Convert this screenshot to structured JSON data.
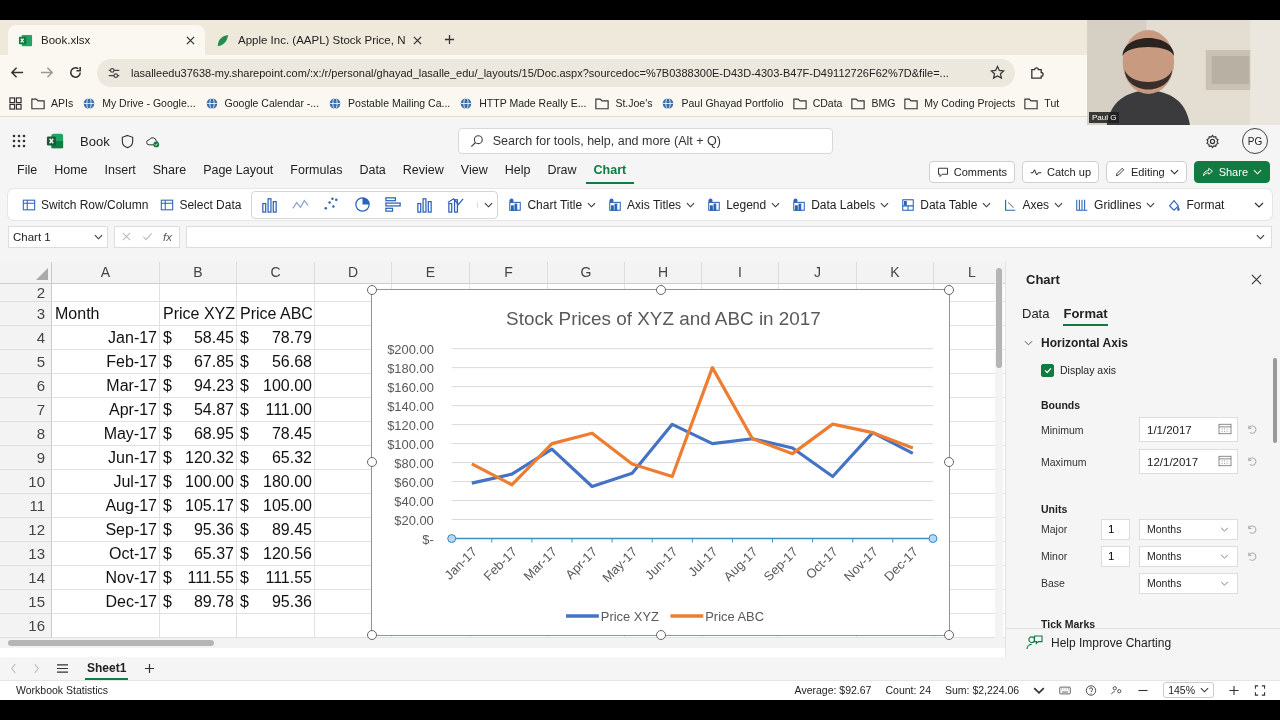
{
  "browser": {
    "tabs": [
      {
        "title": "Book.xlsx",
        "selected": true
      },
      {
        "title": "Apple Inc. (AAPL) Stock Price, N",
        "selected": false
      }
    ],
    "url": "lasalleedu37638-my.sharepoint.com/:x:/r/personal/ghayad_lasalle_edu/_layouts/15/Doc.aspx?sourcedoc=%7B0388300E-D43D-4303-B47F-D49112726F62%7D&file=...",
    "bookmarks": [
      {
        "label": "APIs",
        "kind": "folder"
      },
      {
        "label": "My Drive - Google...",
        "kind": "site"
      },
      {
        "label": "Google Calendar -...",
        "kind": "site"
      },
      {
        "label": "Postable Mailing Ca...",
        "kind": "site"
      },
      {
        "label": "HTTP Made Really E...",
        "kind": "site"
      },
      {
        "label": "St.Joe's",
        "kind": "folder"
      },
      {
        "label": "Paul Ghayad Portfolio",
        "kind": "site"
      },
      {
        "label": "CData",
        "kind": "folder"
      },
      {
        "label": "BMG",
        "kind": "folder"
      },
      {
        "label": "My Coding Projects",
        "kind": "folder"
      },
      {
        "label": "Tut",
        "kind": "folder"
      }
    ]
  },
  "webcam": {
    "kind": "picture",
    "name_tag": "Paul G"
  },
  "app": {
    "doc_title": "Book",
    "search": {
      "placeholder": "Search for tools, help, and more (Alt + Q)"
    },
    "avatar": "PG"
  },
  "menu": [
    {
      "label": "File",
      "selected": false
    },
    {
      "label": "Home",
      "selected": false
    },
    {
      "label": "Insert",
      "selected": false
    },
    {
      "label": "Share",
      "selected": false
    },
    {
      "label": "Page Layout",
      "selected": false
    },
    {
      "label": "Formulas",
      "selected": false
    },
    {
      "label": "Data",
      "selected": false
    },
    {
      "label": "Review",
      "selected": false
    },
    {
      "label": "View",
      "selected": false
    },
    {
      "label": "Help",
      "selected": false
    },
    {
      "label": "Draw",
      "selected": false
    },
    {
      "label": "Chart",
      "selected": true
    }
  ],
  "header_buttons": [
    {
      "label": "Comments",
      "kind": "plain",
      "dropdown": false
    },
    {
      "label": "Catch up",
      "kind": "plain",
      "dropdown": false
    },
    {
      "label": "Editing",
      "kind": "plain",
      "dropdown": true
    },
    {
      "label": "Share",
      "kind": "primary",
      "dropdown": true
    }
  ],
  "ribbon": {
    "actions": [
      {
        "label": "Switch Row/Column"
      },
      {
        "label": "Select Data"
      }
    ],
    "elements": [
      {
        "label": "Chart Title",
        "dropdown": true
      },
      {
        "label": "Axis Titles",
        "dropdown": true
      },
      {
        "label": "Legend",
        "dropdown": true
      },
      {
        "label": "Data Labels",
        "dropdown": true
      },
      {
        "label": "Data Table",
        "dropdown": true
      },
      {
        "label": "Axes",
        "dropdown": true
      },
      {
        "label": "Gridlines",
        "dropdown": true
      },
      {
        "label": "Format",
        "dropdown": false
      }
    ]
  },
  "formula_bar": {
    "name_box": "Chart 1",
    "function_label": "fx"
  },
  "sheet": {
    "columns": [
      "A",
      "B",
      "C",
      "D",
      "E",
      "F",
      "G",
      "H",
      "I",
      "J",
      "K",
      "L"
    ],
    "rows": [
      {
        "num": "2",
        "cells": []
      },
      {
        "num": "3",
        "cells": [
          {
            "kind": "text",
            "text": "Month"
          },
          {
            "kind": "text",
            "text": "Price XYZ"
          },
          {
            "kind": "text",
            "text": "Price ABC"
          }
        ]
      },
      {
        "num": "4",
        "cells": [
          {
            "kind": "date",
            "text": "Jan-17"
          },
          {
            "kind": "money",
            "symbol": "$",
            "amount": "58.45"
          },
          {
            "kind": "money",
            "symbol": "$",
            "amount": "78.79"
          }
        ]
      },
      {
        "num": "5",
        "cells": [
          {
            "kind": "date",
            "text": "Feb-17"
          },
          {
            "kind": "money",
            "symbol": "$",
            "amount": "67.85"
          },
          {
            "kind": "money",
            "symbol": "$",
            "amount": "56.68"
          }
        ]
      },
      {
        "num": "6",
        "cells": [
          {
            "kind": "date",
            "text": "Mar-17"
          },
          {
            "kind": "money",
            "symbol": "$",
            "amount": "94.23"
          },
          {
            "kind": "money",
            "symbol": "$",
            "amount": "100.00"
          }
        ]
      },
      {
        "num": "7",
        "cells": [
          {
            "kind": "date",
            "text": "Apr-17"
          },
          {
            "kind": "money",
            "symbol": "$",
            "amount": "54.87"
          },
          {
            "kind": "money",
            "symbol": "$",
            "amount": "111.00"
          }
        ]
      },
      {
        "num": "8",
        "cells": [
          {
            "kind": "date",
            "text": "May-17"
          },
          {
            "kind": "money",
            "symbol": "$",
            "amount": "68.95"
          },
          {
            "kind": "money",
            "symbol": "$",
            "amount": "78.45"
          }
        ]
      },
      {
        "num": "9",
        "cells": [
          {
            "kind": "date",
            "text": "Jun-17"
          },
          {
            "kind": "money",
            "symbol": "$",
            "amount": "120.32"
          },
          {
            "kind": "money",
            "symbol": "$",
            "amount": "65.32"
          }
        ]
      },
      {
        "num": "10",
        "cells": [
          {
            "kind": "date",
            "text": "Jul-17"
          },
          {
            "kind": "money",
            "symbol": "$",
            "amount": "100.00"
          },
          {
            "kind": "money",
            "symbol": "$",
            "amount": "180.00"
          }
        ]
      },
      {
        "num": "11",
        "cells": [
          {
            "kind": "date",
            "text": "Aug-17"
          },
          {
            "kind": "money",
            "symbol": "$",
            "amount": "105.17"
          },
          {
            "kind": "money",
            "symbol": "$",
            "amount": "105.00"
          }
        ]
      },
      {
        "num": "12",
        "cells": [
          {
            "kind": "date",
            "text": "Sep-17"
          },
          {
            "kind": "money",
            "symbol": "$",
            "amount": "95.36"
          },
          {
            "kind": "money",
            "symbol": "$",
            "amount": "89.45"
          }
        ]
      },
      {
        "num": "13",
        "cells": [
          {
            "kind": "date",
            "text": "Oct-17"
          },
          {
            "kind": "money",
            "symbol": "$",
            "amount": "65.37"
          },
          {
            "kind": "money",
            "symbol": "$",
            "amount": "120.56"
          }
        ]
      },
      {
        "num": "14",
        "cells": [
          {
            "kind": "date",
            "text": "Nov-17"
          },
          {
            "kind": "money",
            "symbol": "$",
            "amount": "111.55"
          },
          {
            "kind": "money",
            "symbol": "$",
            "amount": "111.55"
          }
        ]
      },
      {
        "num": "15",
        "cells": [
          {
            "kind": "date",
            "text": "Dec-17"
          },
          {
            "kind": "money",
            "symbol": "$",
            "amount": "89.78"
          },
          {
            "kind": "money",
            "symbol": "$",
            "amount": "95.36"
          }
        ]
      },
      {
        "num": "16",
        "cells": []
      }
    ],
    "chart": {
      "selected": true,
      "chart_data": {
        "type": "line",
        "title": "Stock Prices of XYZ and ABC in 2017",
        "categories": [
          "Jan-17",
          "Feb-17",
          "Mar-17",
          "Apr-17",
          "May-17",
          "Jun-17",
          "Jul-17",
          "Aug-17",
          "Sep-17",
          "Oct-17",
          "Nov-17",
          "Dec-17"
        ],
        "series": [
          {
            "name": "Price XYZ",
            "color": "#4472c4",
            "values": [
              58.45,
              67.85,
              94.23,
              54.87,
              68.95,
              120.32,
              100,
              105.17,
              95.36,
              65.37,
              111.55,
              89.78
            ]
          },
          {
            "name": "Price ABC",
            "color": "#ed7d31",
            "values": [
              78.79,
              56.68,
              100,
              111,
              78.45,
              65.32,
              180,
              105,
              89.45,
              120.56,
              111.55,
              95.36
            ]
          }
        ],
        "ylim": [
          0,
          200
        ],
        "grid": true,
        "legend": "bottom",
        "yticks": [
          {
            "value": 0,
            "label": "$-"
          },
          {
            "value": 20,
            "label": "$20.00"
          },
          {
            "value": 40,
            "label": "$40.00"
          },
          {
            "value": 60,
            "label": "$60.00"
          },
          {
            "value": 80,
            "label": "$80.00"
          },
          {
            "value": 100,
            "label": "$100.00"
          },
          {
            "value": 120,
            "label": "$120.00"
          },
          {
            "value": 140,
            "label": "$140.00"
          },
          {
            "value": 160,
            "label": "$160.00"
          },
          {
            "value": 180,
            "label": "$180.00"
          },
          {
            "value": 200,
            "label": "$200.00"
          }
        ]
      }
    }
  },
  "panel": {
    "title": "Chart",
    "tabs": [
      {
        "label": "Data",
        "selected": false
      },
      {
        "label": "Format",
        "selected": true
      }
    ],
    "section": {
      "title": "Horizontal Axis",
      "expanded": true
    },
    "display_axis": {
      "label": "Display axis",
      "checked": true
    },
    "bounds": {
      "title": "Bounds",
      "fields": [
        {
          "label": "Minimum",
          "value": "1/1/2017",
          "reset": true
        },
        {
          "label": "Maximum",
          "value": "12/1/2017",
          "reset": true
        }
      ]
    },
    "units": {
      "title": "Units",
      "rows": [
        {
          "label": "Major",
          "count": "1",
          "unit": "Months",
          "reset": true
        },
        {
          "label": "Minor",
          "count": "1",
          "unit": "Months",
          "reset": true
        },
        {
          "label": "Base",
          "unit": "Months",
          "reset": false
        }
      ]
    },
    "next_section": "Tick Marks",
    "feedback": "Help Improve Charting"
  },
  "sheet_tabs": [
    {
      "label": "Sheet1",
      "selected": true
    }
  ],
  "status_bar": {
    "left": "Workbook Statistics",
    "stats": [
      "Average: $92.67",
      "Count: 24",
      "Sum: $2,224.06"
    ],
    "zoom": "145%"
  }
}
